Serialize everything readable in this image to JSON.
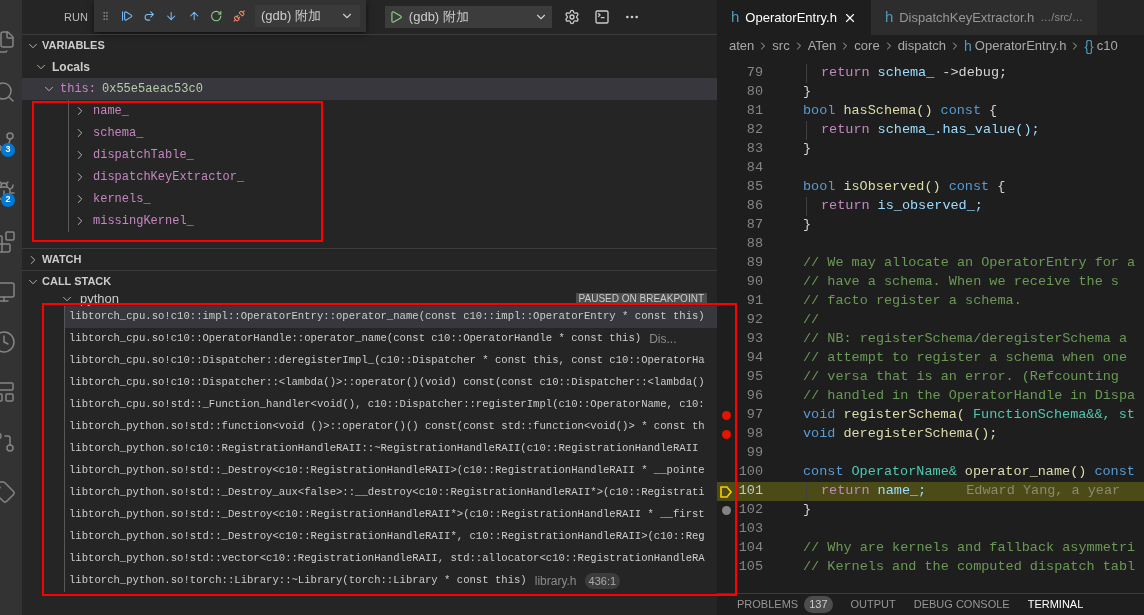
{
  "activity_bar": {
    "items": [
      {
        "kind": "files"
      },
      {
        "kind": "search"
      },
      {
        "kind": "branch",
        "badge": "3"
      },
      {
        "kind": "run",
        "badge": "2"
      },
      {
        "kind": "blocks"
      },
      {
        "kind": "monitor"
      },
      {
        "kind": "clock"
      },
      {
        "kind": "layout"
      },
      {
        "kind": "pull"
      },
      {
        "kind": "tag"
      }
    ]
  },
  "sidebar": {
    "title": "RUN"
  },
  "debug_toolbar": {
    "config": "(gdb) 附加"
  },
  "launch": {
    "config": "(gdb) 附加"
  },
  "variables": {
    "title": "VARIABLES",
    "expanded": true,
    "scopes": [
      {
        "label": "Locals",
        "expanded": true,
        "children": [
          {
            "name": "this:",
            "value": "0x55e5aeac53c0",
            "expanded": true,
            "selected": true,
            "children": [
              {
                "name": "name_",
                "expanded": false,
                "selected": false
              },
              {
                "name": "schema_",
                "expanded": false,
                "selected": false
              },
              {
                "name": "dispatchTable_",
                "expanded": false,
                "selected": false
              },
              {
                "name": "dispatchKeyExtractor_",
                "expanded": false,
                "selected": false
              },
              {
                "name": "kernels_",
                "expanded": false,
                "selected": false
              },
              {
                "name": "missingKernel_",
                "expanded": false,
                "selected": false
              }
            ]
          }
        ]
      }
    ]
  },
  "watch": {
    "title": "WATCH",
    "expanded": false
  },
  "call_stack": {
    "title": "CALL STACK",
    "expanded": true,
    "threads": [
      {
        "name": "python",
        "expanded": true,
        "status": "PAUSED ON BREAKPOINT",
        "frames": [
          {
            "text": "libtorch_cpu.so!c10::impl::OperatorEntry::operator_name(const c10::impl::OperatorEntry * const this)",
            "selected": true
          },
          {
            "text": "libtorch_cpu.so!c10::OperatorHandle::operator_name(const c10::OperatorHandle * const this)",
            "source": "Dis...",
            "selected": false
          },
          {
            "text": "libtorch_cpu.so!c10::Dispatcher::deregisterImpl_(c10::Dispatcher * const this, const c10::OperatorHa",
            "selected": false
          },
          {
            "text": "libtorch_cpu.so!c10::Dispatcher::<lambda()>::operator()(void) const(const c10::Dispatcher::<lambda()",
            "selected": false
          },
          {
            "text": "libtorch_cpu.so!std::_Function_handler<void(), c10::Dispatcher::registerImpl(c10::OperatorName, c10:",
            "selected": false
          },
          {
            "text": "libtorch_python.so!std::function<void ()>::operator()() const(const std::function<void()> * const th",
            "selected": false
          },
          {
            "text": "libtorch_python.so!c10::RegistrationHandleRAII::~RegistrationHandleRAII(c10::RegistrationHandleRAII",
            "selected": false
          },
          {
            "text": "libtorch_python.so!std::_Destroy<c10::RegistrationHandleRAII>(c10::RegistrationHandleRAII * __pointe",
            "selected": false
          },
          {
            "text": "libtorch_python.so!std::_Destroy_aux<false>::__destroy<c10::RegistrationHandleRAII*>(c10::Registrati",
            "selected": false
          },
          {
            "text": "libtorch_python.so!std::_Destroy<c10::RegistrationHandleRAII*>(c10::RegistrationHandleRAII * __first",
            "selected": false
          },
          {
            "text": "libtorch_python.so!std::_Destroy<c10::RegistrationHandleRAII*, c10::RegistrationHandleRAII>(c10::Reg",
            "selected": false
          },
          {
            "text": "libtorch_python.so!std::vector<c10::RegistrationHandleRAII, std::allocator<c10::RegistrationHandleRA",
            "selected": false
          },
          {
            "text": "libtorch_python.so!torch::Library::~Library(torch::Library * const this)",
            "source": "library.h",
            "position": "436:1",
            "selected": false
          }
        ]
      }
    ]
  },
  "editor": {
    "tabs": [
      {
        "icon": "h",
        "label": "OperatorEntry.h",
        "selected": true,
        "closable": true
      },
      {
        "icon": "h",
        "label": "DispatchKeyExtractor.h",
        "description": "…/src/…",
        "selected": false,
        "closable": false
      }
    ],
    "breadcrumb": [
      {
        "label": "aten"
      },
      {
        "label": "src"
      },
      {
        "label": "ATen"
      },
      {
        "label": "core"
      },
      {
        "label": "dispatch"
      },
      {
        "icon": "h",
        "label": "OperatorEntry.h"
      },
      {
        "icon": "{}",
        "label": "c10"
      }
    ],
    "lines": [
      {
        "n": "79",
        "indented": true,
        "segs": [
          {
            "text": "return",
            "kind": "control"
          },
          {
            "text": "schema_",
            "kind": "variable"
          },
          {
            "text": "->debug;",
            "kind": "plain"
          }
        ]
      },
      {
        "n": "80",
        "indented": false,
        "segs": [
          {
            "text": "}",
            "kind": "plain"
          }
        ]
      },
      {
        "n": "81",
        "indented": false,
        "segs": [
          {
            "text": "bool",
            "kind": "keyword"
          },
          {
            "text": "hasSchema()",
            "kind": "function"
          },
          {
            "text": "const",
            "kind": "keyword"
          },
          {
            "text": "{",
            "kind": "plain"
          }
        ]
      },
      {
        "n": "82",
        "indented": true,
        "segs": [
          {
            "text": "return",
            "kind": "control"
          },
          {
            "text": "schema_.has_value();",
            "kind": "variable"
          }
        ]
      },
      {
        "n": "83",
        "indented": false,
        "segs": [
          {
            "text": "}",
            "kind": "plain"
          }
        ]
      },
      {
        "n": "84",
        "indented": false
      },
      {
        "n": "85",
        "indented": false,
        "segs": [
          {
            "text": "bool",
            "kind": "keyword"
          },
          {
            "text": "isObserved()",
            "kind": "function"
          },
          {
            "text": "const",
            "kind": "keyword"
          },
          {
            "text": "{",
            "kind": "plain"
          }
        ]
      },
      {
        "n": "86",
        "indented": true,
        "segs": [
          {
            "text": "return",
            "kind": "control"
          },
          {
            "text": "is_observed_;",
            "kind": "variable"
          }
        ]
      },
      {
        "n": "87",
        "indented": false,
        "segs": [
          {
            "text": "}",
            "kind": "plain"
          }
        ]
      },
      {
        "n": "88",
        "indented": false
      },
      {
        "n": "89",
        "indented": false,
        "segs": [
          {
            "text": "// We may allocate an OperatorEntry for a",
            "kind": "comment"
          }
        ]
      },
      {
        "n": "90",
        "indented": false,
        "segs": [
          {
            "text": "// have a schema.  When we receive the s",
            "kind": "comment"
          }
        ]
      },
      {
        "n": "91",
        "indented": false,
        "segs": [
          {
            "text": "// facto register a schema.",
            "kind": "comment"
          }
        ]
      },
      {
        "n": "92",
        "indented": false,
        "segs": [
          {
            "text": "//",
            "kind": "comment"
          }
        ]
      },
      {
        "n": "93",
        "indented": false,
        "segs": [
          {
            "text": "// NB: registerSchema/deregisterSchema a",
            "kind": "comment"
          }
        ]
      },
      {
        "n": "94",
        "indented": false,
        "segs": [
          {
            "text": "// attempt to register a schema when one",
            "kind": "comment"
          }
        ]
      },
      {
        "n": "95",
        "indented": false,
        "segs": [
          {
            "text": "// versa that is an error.  (Refcounting",
            "kind": "comment"
          }
        ]
      },
      {
        "n": "96",
        "indented": false,
        "segs": [
          {
            "text": "// handled in the OperatorHandle in Dispa",
            "kind": "comment"
          }
        ]
      },
      {
        "n": "97",
        "kind": "breakpoint",
        "indented": false,
        "segs": [
          {
            "text": "void",
            "kind": "keyword"
          },
          {
            "text": "registerSchema(",
            "kind": "function"
          },
          {
            "text": "FunctionSchema&&,",
            "kind": "type"
          },
          {
            "text": "st",
            "kind": "type"
          }
        ]
      },
      {
        "n": "98",
        "kind": "breakpoint",
        "indented": false,
        "segs": [
          {
            "text": "void",
            "kind": "keyword"
          },
          {
            "text": "deregisterSchema();",
            "kind": "function"
          }
        ]
      },
      {
        "n": "99",
        "indented": false
      },
      {
        "n": "100",
        "indented": false,
        "segs": [
          {
            "text": "const",
            "kind": "keyword"
          },
          {
            "text": "OperatorName&",
            "kind": "type"
          },
          {
            "text": "operator_name()",
            "kind": "function"
          },
          {
            "text": "const",
            "kind": "keyword"
          }
        ]
      },
      {
        "n": "101",
        "kind": "current",
        "indented": true,
        "blame": "Edward Yang, a year",
        "segs": [
          {
            "text": "return",
            "kind": "control"
          },
          {
            "text": "name_;",
            "kind": "variable"
          }
        ]
      },
      {
        "n": "102",
        "kind": "disabled-breakpoint",
        "indented": false,
        "segs": [
          {
            "text": "}",
            "kind": "plain"
          }
        ]
      },
      {
        "n": "103",
        "indented": false
      },
      {
        "n": "104",
        "indented": false,
        "segs": [
          {
            "text": "// Why are kernels and fallback asymmetri",
            "kind": "comment"
          }
        ]
      },
      {
        "n": "105",
        "indented": false,
        "segs": [
          {
            "text": "// Kernels and the computed dispatch tabl",
            "kind": "comment"
          }
        ]
      }
    ]
  },
  "panel_tabs": [
    {
      "label": "PROBLEMS",
      "badge": "137",
      "selected": false
    },
    {
      "label": "OUTPUT",
      "selected": false
    },
    {
      "label": "DEBUG CONSOLE",
      "selected": false
    },
    {
      "label": "TERMINAL",
      "selected": true
    }
  ]
}
